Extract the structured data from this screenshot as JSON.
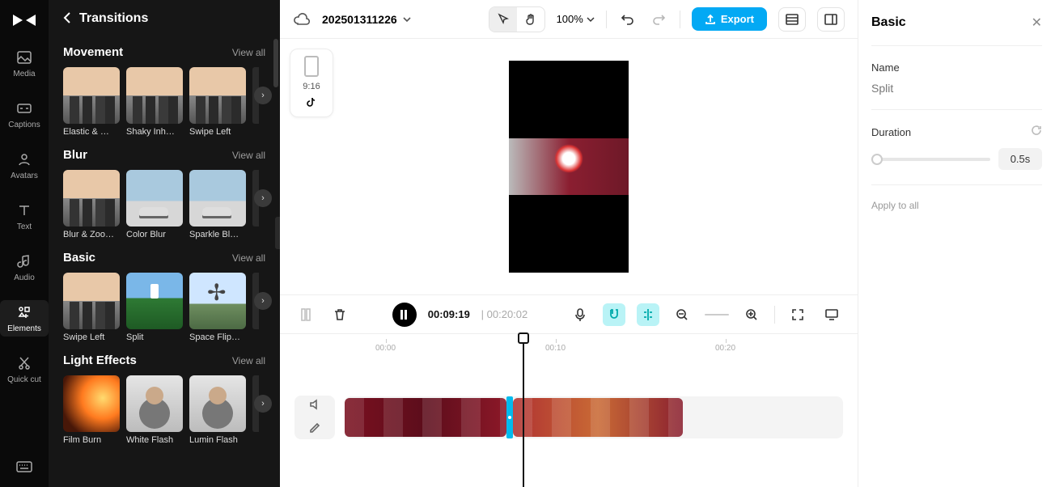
{
  "rail": {
    "items": [
      {
        "label": "Media"
      },
      {
        "label": "Captions"
      },
      {
        "label": "Avatars"
      },
      {
        "label": "Text"
      },
      {
        "label": "Audio"
      },
      {
        "label": "Elements"
      },
      {
        "label": "Quick cut"
      }
    ]
  },
  "sidebar": {
    "title": "Transitions",
    "view_all": "View all",
    "categories": [
      {
        "name": "Movement",
        "items": [
          "Elastic & …",
          "Shaky Inh…",
          "Swipe Left"
        ]
      },
      {
        "name": "Blur",
        "items": [
          "Blur & Zoo…",
          "Color Blur",
          "Sparkle Bl…"
        ]
      },
      {
        "name": "Basic",
        "items": [
          "Swipe Left",
          "Split",
          "Space Flip…"
        ]
      },
      {
        "name": "Light Effects",
        "items": [
          "Film Burn",
          "White Flash",
          "Lumin Flash"
        ]
      }
    ]
  },
  "topbar": {
    "project": "202501311226",
    "zoom": "100%",
    "export": "Export"
  },
  "ratio_card": {
    "ratio": "9:16",
    "platform_icon": "tiktok-icon"
  },
  "controls": {
    "current": "00:09:19",
    "total": "00:20:02"
  },
  "ruler": {
    "ticks": [
      "00:00",
      "00:10",
      "00:20"
    ]
  },
  "right_panel": {
    "title": "Basic",
    "name_label": "Name",
    "name_value": "Split",
    "duration_label": "Duration",
    "duration_value": "0.5s",
    "apply_all": "Apply to all"
  }
}
